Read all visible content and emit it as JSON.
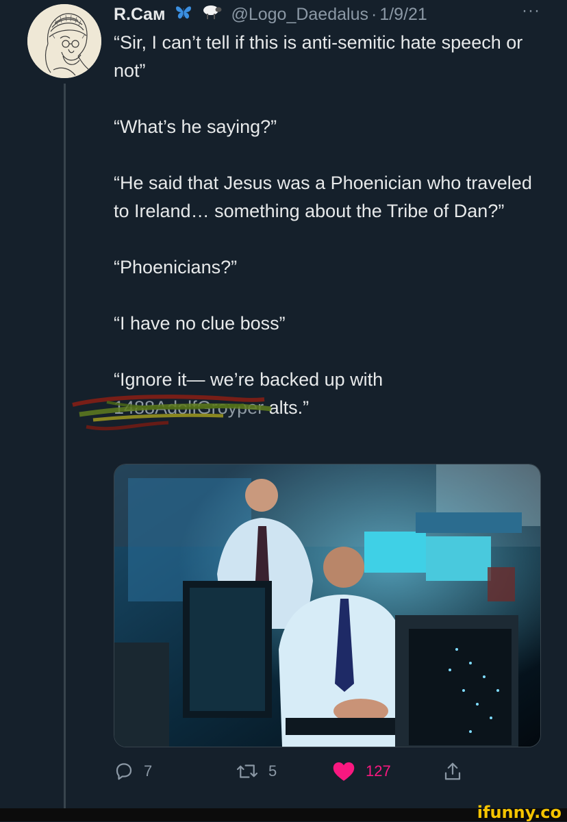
{
  "tweet": {
    "display_name": "R.Cам",
    "emojis": [
      "butterfly-emoji",
      "sheep-emoji"
    ],
    "handle": "@Logo_Daedalus",
    "separator": "·",
    "date": "1/9/21",
    "more": "···",
    "paragraphs": [
      "“Sir, I can’t tell if this is anti-semitic hate speech or not”",
      "“What’s he saying?”",
      "“He said that Jesus was a Phoenician who traveled to Ireland… something about the Tribe of Dan?”",
      "“Phoenicians?”",
      "“I have no clue boss”"
    ],
    "last_paragraph_start": "“Ignore it— we’re backed up with",
    "redacted_text": "1488AdolfGroyper",
    "last_paragraph_end": " alts.”",
    "media_alt": "Two men in shirts and ties looking at computer monitors in a dark blue-lit room"
  },
  "actions": {
    "reply_count": "7",
    "retweet_count": "5",
    "like_count": "127",
    "reply_icon": "reply-icon",
    "retweet_icon": "retweet-icon",
    "like_icon": "heart-icon",
    "share_icon": "share-icon"
  },
  "watermark": "ifunny.co",
  "colors": {
    "background": "#15202b",
    "text": "#e7e9ea",
    "secondary": "#8b98a5",
    "like": "#f91880",
    "watermark": "#f5c400"
  }
}
